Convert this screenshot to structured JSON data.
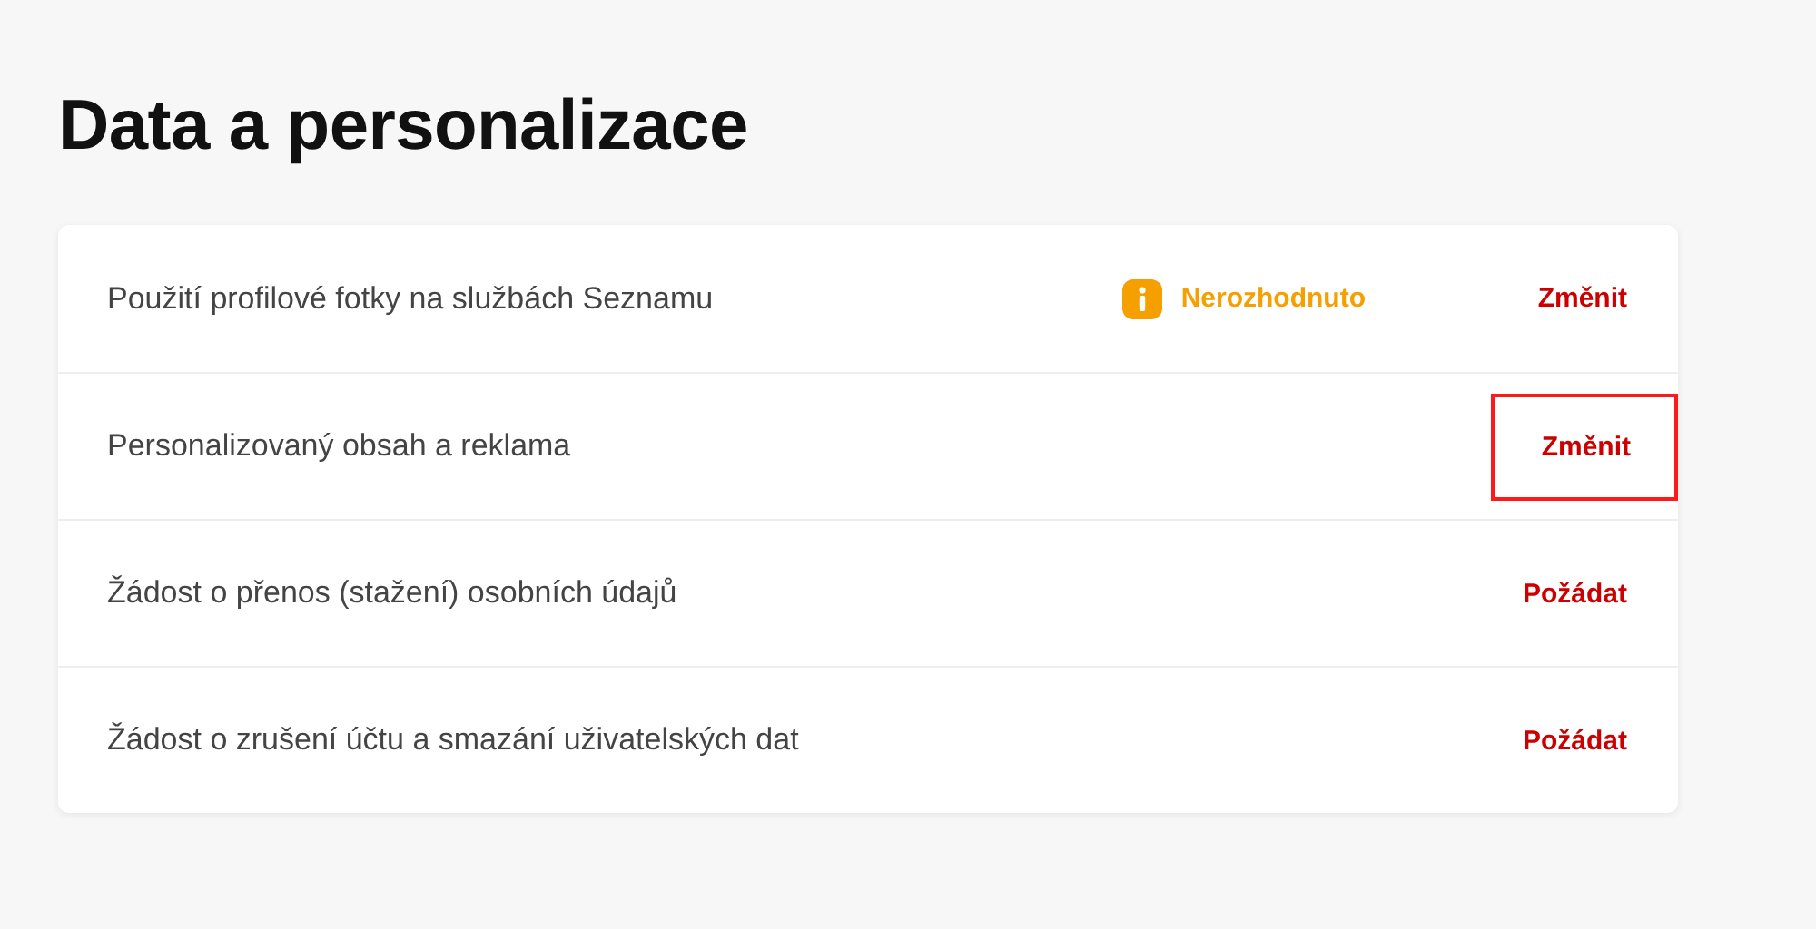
{
  "title": "Data a personalizace",
  "rows": [
    {
      "label": "Použití profilové fotky na službách Seznamu",
      "status": {
        "kind": "warning",
        "text": "Nerozhodnuto"
      },
      "action": "Změnit",
      "highlighted": false
    },
    {
      "label": "Personalizovaný obsah a reklama",
      "action": "Změnit",
      "highlighted": true
    },
    {
      "label": "Žádost o přenos (stažení) osobních údajů",
      "action": "Požádat",
      "highlighted": false
    },
    {
      "label": "Žádost o zrušení účtu a smazání uživatelských dat",
      "action": "Požádat",
      "highlighted": false
    }
  ]
}
